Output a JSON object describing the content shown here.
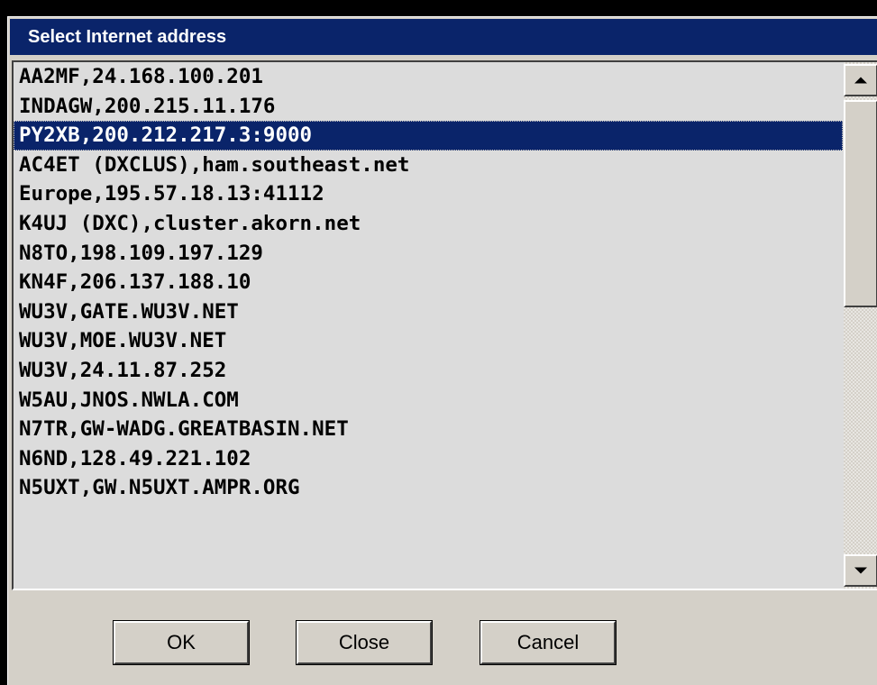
{
  "window": {
    "title": "Select Internet address"
  },
  "list": {
    "items": [
      "AA2MF,24.168.100.201",
      "INDAGW,200.215.11.176",
      "PY2XB,200.212.217.3:9000",
      "AC4ET (DXCLUS),ham.southeast.net",
      "Europe,195.57.18.13:41112",
      "K4UJ (DXC),cluster.akorn.net",
      "N8TO,198.109.197.129",
      "KN4F,206.137.188.10",
      "WU3V,GATE.WU3V.NET",
      "WU3V,MOE.WU3V.NET",
      "WU3V,24.11.87.252",
      "W5AU,JNOS.NWLA.COM",
      "N7TR,GW-WADG.GREATBASIN.NET",
      "N6ND,128.49.221.102",
      "N5UXT,GW.N5UXT.AMPR.ORG"
    ],
    "selected_item": "PY2XB,200.212.217.3:9000"
  },
  "buttons": {
    "ok_label": "OK",
    "close_label": "Close",
    "cancel_label": "Cancel"
  },
  "icons": {
    "scroll_up": "scroll-up-arrow-icon",
    "scroll_down": "scroll-down-arrow-icon"
  },
  "colors": {
    "titlebar": "#0a246a",
    "selection": "#0a246a",
    "dialog_face": "#d4d0c8"
  }
}
